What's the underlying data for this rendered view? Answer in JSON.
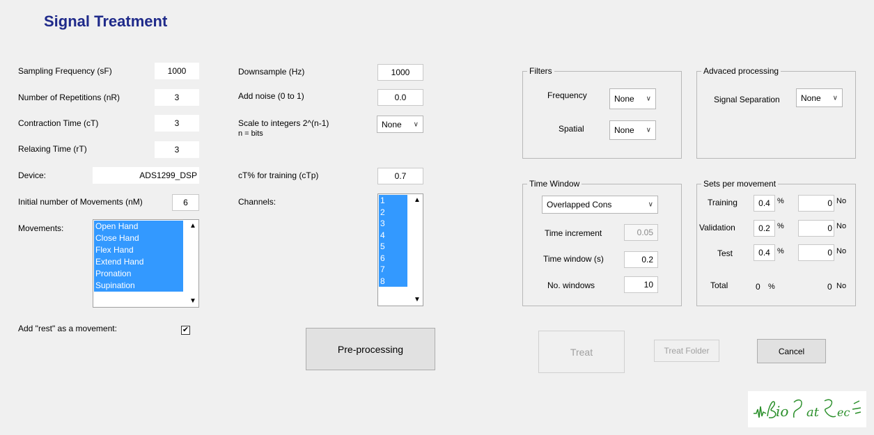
{
  "title": "Signal Treatment",
  "left": {
    "sampling_label": "Sampling Frequency (sF)",
    "sampling_value": "1000",
    "reps_label": "Number of Repetitions  (nR)",
    "reps_value": "3",
    "contraction_label": "Contraction Time  (cT)",
    "contraction_value": "3",
    "relaxing_label": "Relaxing Time  (rT)",
    "relaxing_value": "3",
    "device_label": "Device:",
    "device_value": "ADS1299_DSP",
    "initial_label": "Initial number of Movements (nM)",
    "initial_value": "6",
    "movements_label": "Movements:",
    "movements": [
      "Open Hand",
      "Close Hand",
      "Flex Hand",
      "Extend Hand",
      "Pronation",
      "Supination"
    ],
    "rest_label": "Add \"rest\" as a movement:",
    "rest_checked": true
  },
  "middle": {
    "downsample_label": "Downsample (Hz)",
    "downsample_value": "1000",
    "noise_label": "Add noise (0 to 1)",
    "noise_value": "0.0",
    "scale_label_1": "Scale to integers 2^(n-1)",
    "scale_label_2": "n = bits",
    "scale_value": "None",
    "ctp_label": "cT% for training   (cTp)",
    "ctp_value": "0.7",
    "channels_label": "Channels:",
    "channels": [
      "1",
      "2",
      "3",
      "4",
      "5",
      "6",
      "7",
      "8"
    ],
    "preprocess_label": "Pre-processing"
  },
  "filters": {
    "title": "Filters",
    "frequency_label": "Frequency",
    "frequency_value": "None",
    "spatial_label": "Spatial",
    "spatial_value": "None"
  },
  "advanced": {
    "title": "Advaced processing",
    "separation_label": "Signal Separation",
    "separation_value": "None"
  },
  "time_window": {
    "title": "Time Window",
    "mode_value": "Overlapped Cons",
    "increment_label": "Time increment",
    "increment_value": "0.05",
    "window_label": "Time window (s)",
    "window_value": "0.2",
    "nwindows_label": "No. windows",
    "nwindows_value": "10"
  },
  "sets": {
    "title": "Sets per movement",
    "training_label": "Training",
    "training_pct": "0.4",
    "training_no": "0",
    "validation_label": "Validation",
    "validation_pct": "0.2",
    "validation_no": "0",
    "test_label": "Test",
    "test_pct": "0.4",
    "test_no": "0",
    "total_label": "Total",
    "total_pct": "0",
    "total_no": "0",
    "pct_unit": "%",
    "no_unit": "No"
  },
  "buttons": {
    "treat": "Treat",
    "treat_folder": "Treat Folder",
    "cancel": "Cancel"
  },
  "logo_text": "BioPatRec"
}
